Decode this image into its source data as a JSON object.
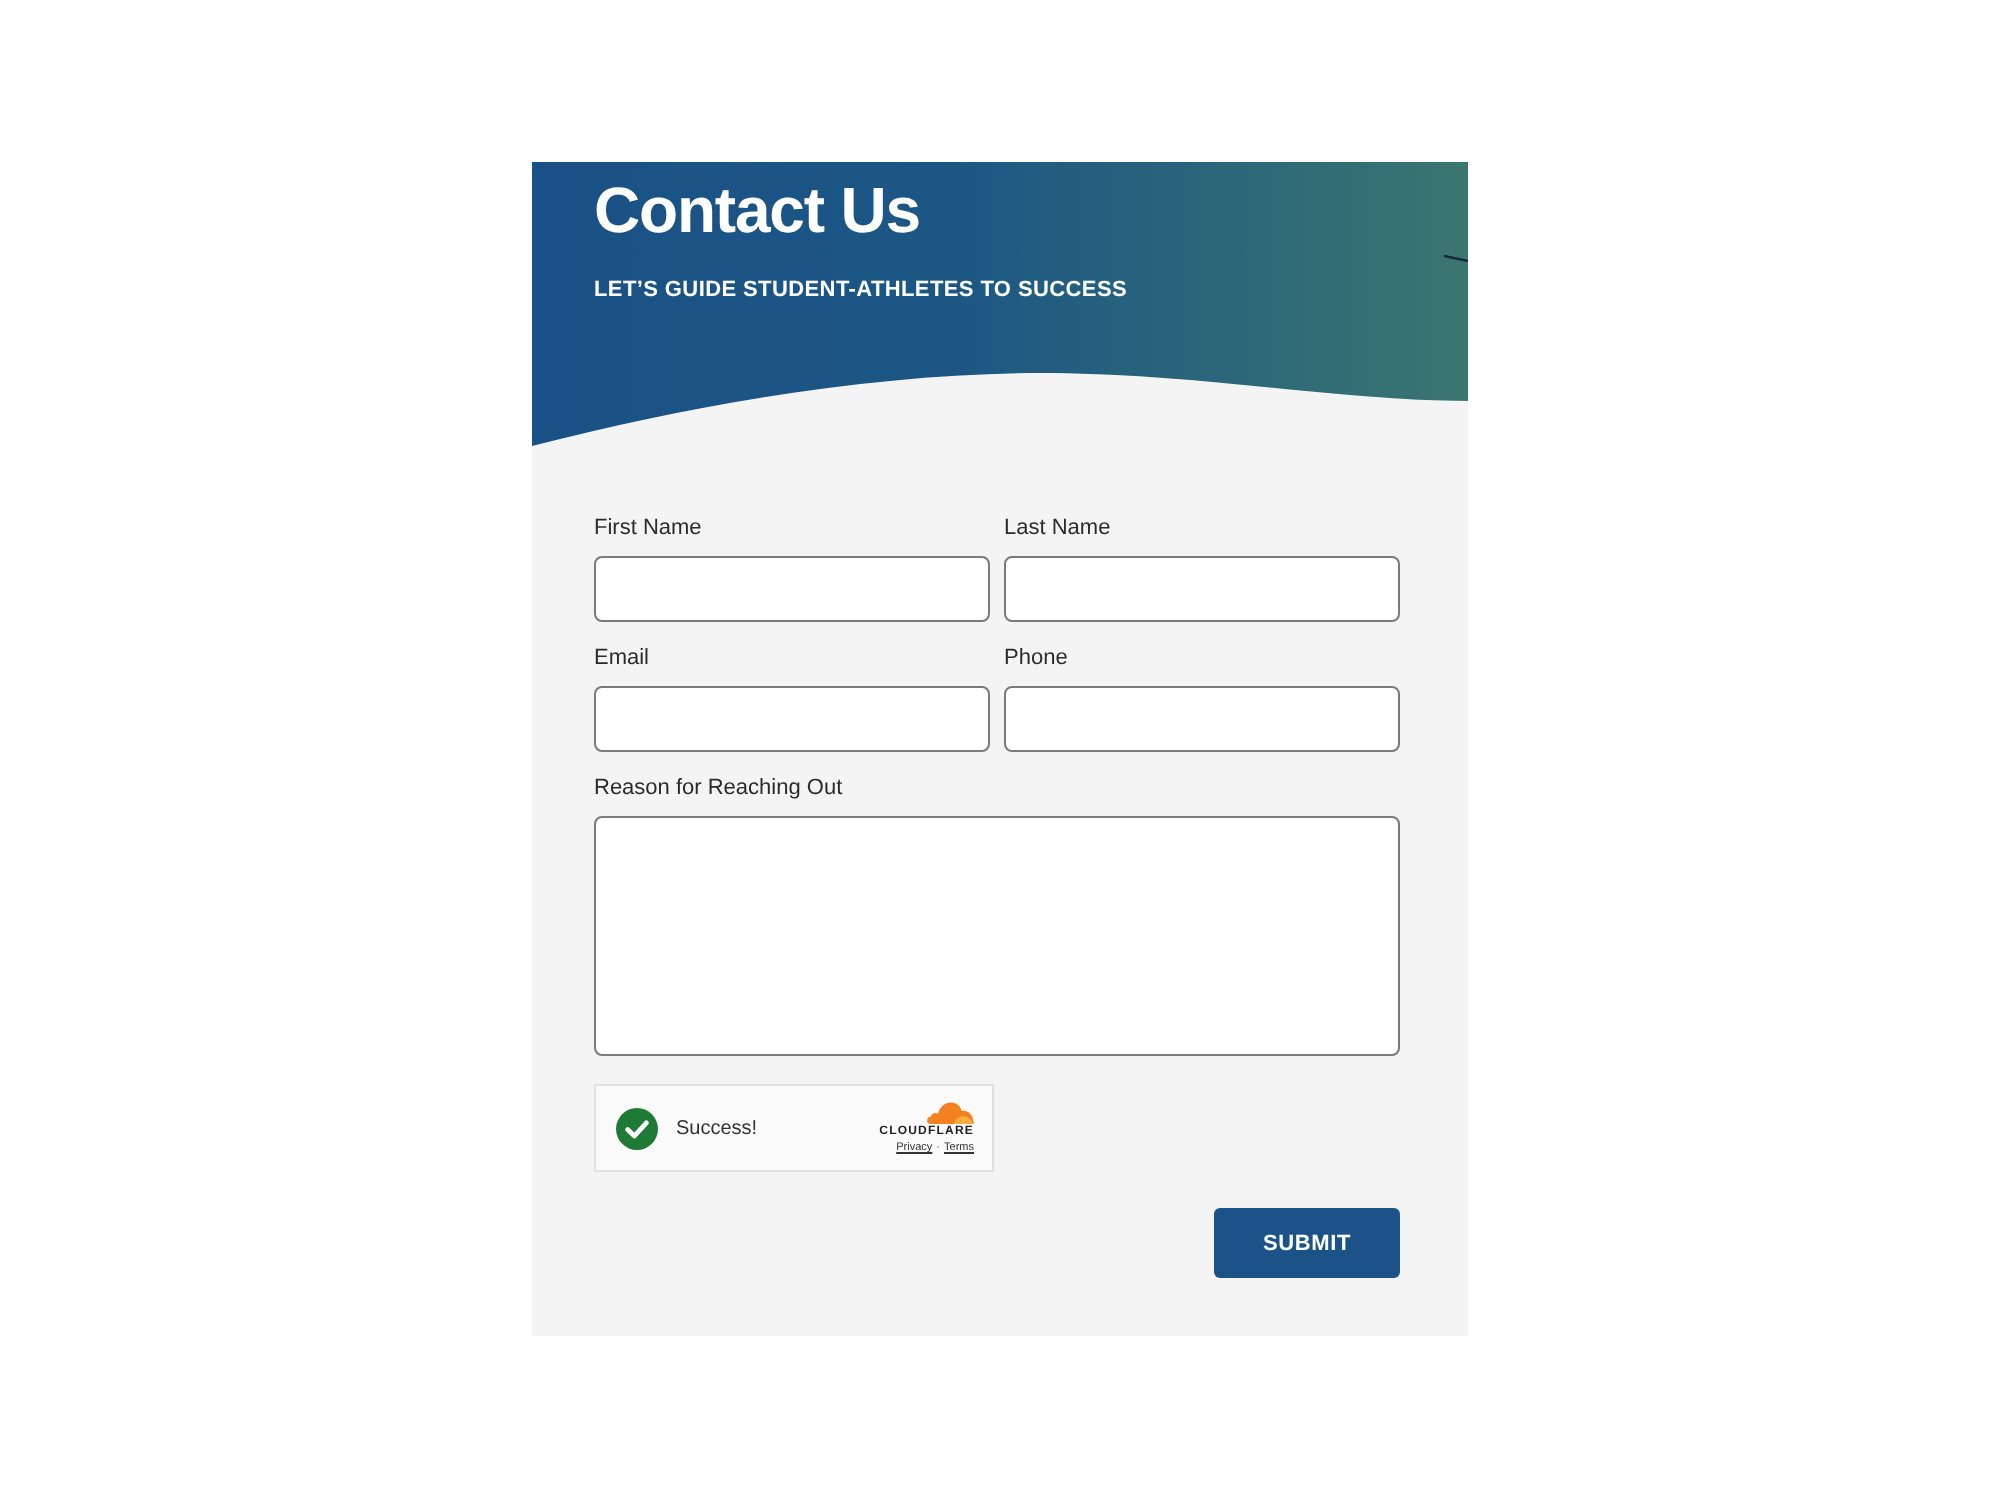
{
  "header": {
    "title": "Contact Us",
    "subtitle": "LET’S GUIDE STUDENT-ATHLETES TO SUCCESS"
  },
  "form": {
    "fields": [
      {
        "label": "First Name",
        "kind": "input"
      },
      {
        "label": "Last Name",
        "kind": "input"
      },
      {
        "label": "Email",
        "kind": "input"
      },
      {
        "label": "Phone",
        "kind": "input"
      },
      {
        "label": "Reason for Reaching Out",
        "kind": "textarea"
      }
    ]
  },
  "captcha": {
    "status": "Success!",
    "verified": true,
    "brand": "CLOUDFLARE",
    "links": [
      "Privacy",
      "Terms"
    ],
    "separator": "·"
  },
  "submit_button": "SUBMIT"
}
